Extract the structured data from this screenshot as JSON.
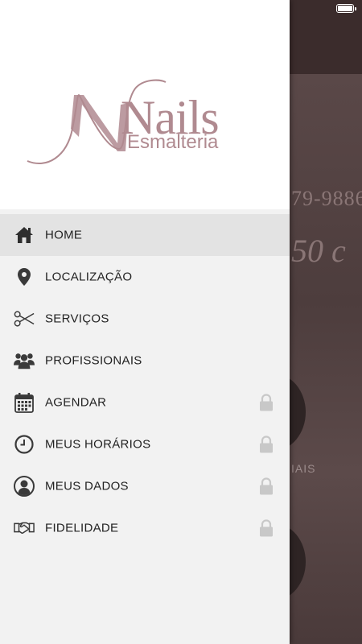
{
  "logo": {
    "brand": "Nails",
    "subtitle": "Esmalteria",
    "color": "#b08a90"
  },
  "menu": {
    "items": [
      {
        "label": "HOME",
        "icon": "home-icon",
        "locked": false,
        "active": true
      },
      {
        "label": "LOCALIZAÇÃO",
        "icon": "location-pin-icon",
        "locked": false,
        "active": false
      },
      {
        "label": "SERVIÇOS",
        "icon": "scissors-icon",
        "locked": false,
        "active": false
      },
      {
        "label": "PROFISSIONAIS",
        "icon": "people-icon",
        "locked": false,
        "active": false
      },
      {
        "label": "AGENDAR",
        "icon": "calendar-icon",
        "locked": true,
        "active": false
      },
      {
        "label": "MEUS HORÁRIOS",
        "icon": "clock-icon",
        "locked": true,
        "active": false
      },
      {
        "label": "MEUS DADOS",
        "icon": "user-icon",
        "locked": true,
        "active": false
      },
      {
        "label": "FIDELIDADE",
        "icon": "handshake-icon",
        "locked": true,
        "active": false
      }
    ]
  },
  "background": {
    "phone_fragment": "79-9886",
    "price_fragment": "50 c",
    "label_fragment": "IAIS"
  },
  "colors": {
    "drawer_bg": "#f2f2f2",
    "active_item_bg": "#e3e3e3",
    "icon": "#3a3a3a",
    "lock": "#c8c8c8"
  }
}
